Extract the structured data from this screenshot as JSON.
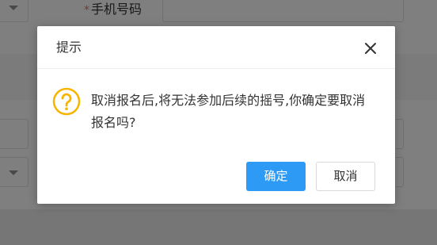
{
  "background": {
    "phone_label": "手机号码",
    "required_mark": "*"
  },
  "dialog": {
    "title": "提示",
    "message": "取消报名后,将无法参加后续的摇号,你确定要取消报名吗?",
    "confirm_label": "确定",
    "cancel_label": "取消"
  },
  "icons": {
    "close": "close-icon",
    "question": "question-circle-icon"
  },
  "colors": {
    "primary": "#2d9af5",
    "warning": "#f7b500",
    "required": "#f56c6c"
  }
}
